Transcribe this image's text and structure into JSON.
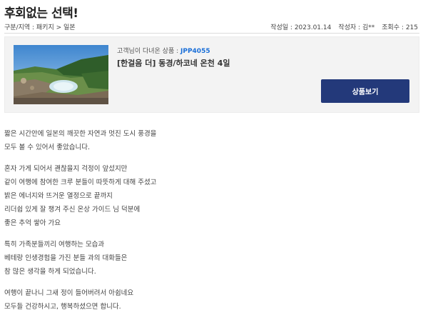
{
  "page": {
    "title": "후회없는 선택!"
  },
  "meta": {
    "breadcrumb": "구분/지역 : 패키지 > 일본",
    "date_label": "작성일 : 2023.01.14",
    "author_label": "작성자 : 김**",
    "views_label": "조회수 : 215"
  },
  "product": {
    "visited_prefix": "고객님이 다녀온 상품 : ",
    "code": "JPP4055",
    "name": "[한걸음 더] 동경/하코네 온천 4일",
    "button_label": "상품보기"
  },
  "review": {
    "paragraphs": [
      [
        "짧은 시간안에 일본의 깨끗한 자연과 멋진 도시 풍경을",
        "모두 볼 수 있어서 좋았습니다."
      ],
      [
        "혼자 가게 되어서 괜찮을지 걱정이 앞섰지만",
        "같이 여행에 참여한 크루 분들이 따뜻하게 대해 주셨고",
        "밝은 에너지와 뜨거운 열정으로 끝까지",
        "리더쉽 있게 잘 챙겨 주신 온상 가이드 님 덕분에",
        "좋은 추억 쌓아 가요"
      ],
      [
        "특히 가족분들끼리 여행하는 모습과",
        "베테랑 인생경험을 가진 분들 과의 대화들은",
        "참 많은 생각을 하게 되었습니다."
      ],
      [
        "여행이 끝나니 그새 정이 들어버려서 아쉽네요",
        "모두들 건강하시고, 행복하셨으면 합니다."
      ]
    ]
  }
}
